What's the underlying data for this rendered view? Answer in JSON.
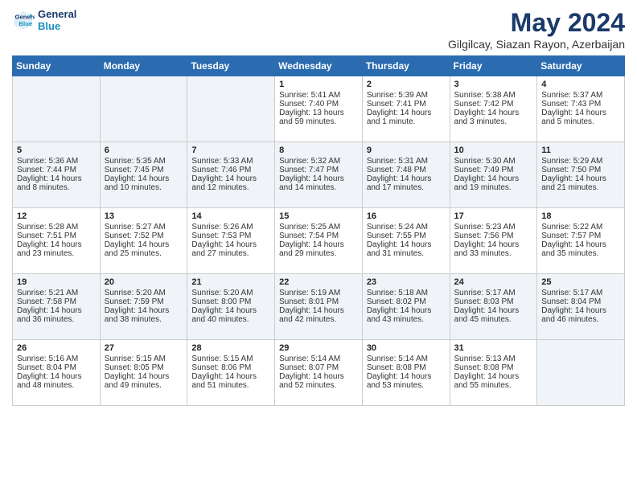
{
  "logo": {
    "line1": "General",
    "line2": "Blue"
  },
  "title": "May 2024",
  "location": "Gilgilcay, Siazan Rayon, Azerbaijan",
  "days_of_week": [
    "Sunday",
    "Monday",
    "Tuesday",
    "Wednesday",
    "Thursday",
    "Friday",
    "Saturday"
  ],
  "weeks": [
    [
      {
        "day": "",
        "sunrise": "",
        "sunset": "",
        "daylight": ""
      },
      {
        "day": "",
        "sunrise": "",
        "sunset": "",
        "daylight": ""
      },
      {
        "day": "",
        "sunrise": "",
        "sunset": "",
        "daylight": ""
      },
      {
        "day": "1",
        "sunrise": "Sunrise: 5:41 AM",
        "sunset": "Sunset: 7:40 PM",
        "daylight": "Daylight: 13 hours and 59 minutes."
      },
      {
        "day": "2",
        "sunrise": "Sunrise: 5:39 AM",
        "sunset": "Sunset: 7:41 PM",
        "daylight": "Daylight: 14 hours and 1 minute."
      },
      {
        "day": "3",
        "sunrise": "Sunrise: 5:38 AM",
        "sunset": "Sunset: 7:42 PM",
        "daylight": "Daylight: 14 hours and 3 minutes."
      },
      {
        "day": "4",
        "sunrise": "Sunrise: 5:37 AM",
        "sunset": "Sunset: 7:43 PM",
        "daylight": "Daylight: 14 hours and 5 minutes."
      }
    ],
    [
      {
        "day": "5",
        "sunrise": "Sunrise: 5:36 AM",
        "sunset": "Sunset: 7:44 PM",
        "daylight": "Daylight: 14 hours and 8 minutes."
      },
      {
        "day": "6",
        "sunrise": "Sunrise: 5:35 AM",
        "sunset": "Sunset: 7:45 PM",
        "daylight": "Daylight: 14 hours and 10 minutes."
      },
      {
        "day": "7",
        "sunrise": "Sunrise: 5:33 AM",
        "sunset": "Sunset: 7:46 PM",
        "daylight": "Daylight: 14 hours and 12 minutes."
      },
      {
        "day": "8",
        "sunrise": "Sunrise: 5:32 AM",
        "sunset": "Sunset: 7:47 PM",
        "daylight": "Daylight: 14 hours and 14 minutes."
      },
      {
        "day": "9",
        "sunrise": "Sunrise: 5:31 AM",
        "sunset": "Sunset: 7:48 PM",
        "daylight": "Daylight: 14 hours and 17 minutes."
      },
      {
        "day": "10",
        "sunrise": "Sunrise: 5:30 AM",
        "sunset": "Sunset: 7:49 PM",
        "daylight": "Daylight: 14 hours and 19 minutes."
      },
      {
        "day": "11",
        "sunrise": "Sunrise: 5:29 AM",
        "sunset": "Sunset: 7:50 PM",
        "daylight": "Daylight: 14 hours and 21 minutes."
      }
    ],
    [
      {
        "day": "12",
        "sunrise": "Sunrise: 5:28 AM",
        "sunset": "Sunset: 7:51 PM",
        "daylight": "Daylight: 14 hours and 23 minutes."
      },
      {
        "day": "13",
        "sunrise": "Sunrise: 5:27 AM",
        "sunset": "Sunset: 7:52 PM",
        "daylight": "Daylight: 14 hours and 25 minutes."
      },
      {
        "day": "14",
        "sunrise": "Sunrise: 5:26 AM",
        "sunset": "Sunset: 7:53 PM",
        "daylight": "Daylight: 14 hours and 27 minutes."
      },
      {
        "day": "15",
        "sunrise": "Sunrise: 5:25 AM",
        "sunset": "Sunset: 7:54 PM",
        "daylight": "Daylight: 14 hours and 29 minutes."
      },
      {
        "day": "16",
        "sunrise": "Sunrise: 5:24 AM",
        "sunset": "Sunset: 7:55 PM",
        "daylight": "Daylight: 14 hours and 31 minutes."
      },
      {
        "day": "17",
        "sunrise": "Sunrise: 5:23 AM",
        "sunset": "Sunset: 7:56 PM",
        "daylight": "Daylight: 14 hours and 33 minutes."
      },
      {
        "day": "18",
        "sunrise": "Sunrise: 5:22 AM",
        "sunset": "Sunset: 7:57 PM",
        "daylight": "Daylight: 14 hours and 35 minutes."
      }
    ],
    [
      {
        "day": "19",
        "sunrise": "Sunrise: 5:21 AM",
        "sunset": "Sunset: 7:58 PM",
        "daylight": "Daylight: 14 hours and 36 minutes."
      },
      {
        "day": "20",
        "sunrise": "Sunrise: 5:20 AM",
        "sunset": "Sunset: 7:59 PM",
        "daylight": "Daylight: 14 hours and 38 minutes."
      },
      {
        "day": "21",
        "sunrise": "Sunrise: 5:20 AM",
        "sunset": "Sunset: 8:00 PM",
        "daylight": "Daylight: 14 hours and 40 minutes."
      },
      {
        "day": "22",
        "sunrise": "Sunrise: 5:19 AM",
        "sunset": "Sunset: 8:01 PM",
        "daylight": "Daylight: 14 hours and 42 minutes."
      },
      {
        "day": "23",
        "sunrise": "Sunrise: 5:18 AM",
        "sunset": "Sunset: 8:02 PM",
        "daylight": "Daylight: 14 hours and 43 minutes."
      },
      {
        "day": "24",
        "sunrise": "Sunrise: 5:17 AM",
        "sunset": "Sunset: 8:03 PM",
        "daylight": "Daylight: 14 hours and 45 minutes."
      },
      {
        "day": "25",
        "sunrise": "Sunrise: 5:17 AM",
        "sunset": "Sunset: 8:04 PM",
        "daylight": "Daylight: 14 hours and 46 minutes."
      }
    ],
    [
      {
        "day": "26",
        "sunrise": "Sunrise: 5:16 AM",
        "sunset": "Sunset: 8:04 PM",
        "daylight": "Daylight: 14 hours and 48 minutes."
      },
      {
        "day": "27",
        "sunrise": "Sunrise: 5:15 AM",
        "sunset": "Sunset: 8:05 PM",
        "daylight": "Daylight: 14 hours and 49 minutes."
      },
      {
        "day": "28",
        "sunrise": "Sunrise: 5:15 AM",
        "sunset": "Sunset: 8:06 PM",
        "daylight": "Daylight: 14 hours and 51 minutes."
      },
      {
        "day": "29",
        "sunrise": "Sunrise: 5:14 AM",
        "sunset": "Sunset: 8:07 PM",
        "daylight": "Daylight: 14 hours and 52 minutes."
      },
      {
        "day": "30",
        "sunrise": "Sunrise: 5:14 AM",
        "sunset": "Sunset: 8:08 PM",
        "daylight": "Daylight: 14 hours and 53 minutes."
      },
      {
        "day": "31",
        "sunrise": "Sunrise: 5:13 AM",
        "sunset": "Sunset: 8:08 PM",
        "daylight": "Daylight: 14 hours and 55 minutes."
      },
      {
        "day": "",
        "sunrise": "",
        "sunset": "",
        "daylight": ""
      }
    ]
  ]
}
